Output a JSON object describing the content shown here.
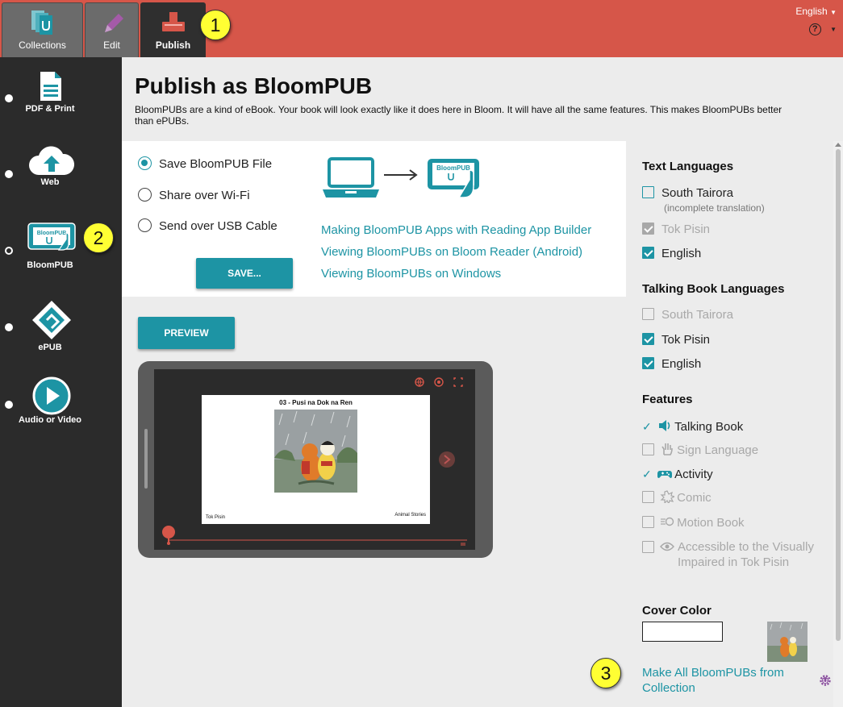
{
  "tabs": {
    "collections_label": "Collections",
    "edit_label": "Edit",
    "publish_label": "Publish"
  },
  "header": {
    "ui_language": "English",
    "help_glyph": "?"
  },
  "callouts": {
    "one": "1",
    "two": "2",
    "three": "3"
  },
  "sidebar": {
    "items": [
      {
        "label": "PDF & Print",
        "icon": "document-icon"
      },
      {
        "label": "Web",
        "icon": "cloud-upload-icon"
      },
      {
        "label": "BloomPUB",
        "icon": "bloompub-device-icon",
        "selected": true
      },
      {
        "label": "ePUB",
        "icon": "epub-icon"
      },
      {
        "label": "Audio or Video",
        "icon": "play-icon"
      }
    ]
  },
  "main": {
    "title": "Publish as BloomPUB",
    "description": "BloomPUBs are a kind of eBook. Your book will look exactly like it does here in Bloom. It will have all the same features. This makes BloomPUBs better than ePUBs.",
    "methods": [
      {
        "label": "Save BloomPUB File",
        "selected": true
      },
      {
        "label": "Share over Wi-Fi",
        "selected": false
      },
      {
        "label": "Send over USB Cable",
        "selected": false
      }
    ],
    "save_button": "SAVE...",
    "device_badge": "BloomPUB",
    "links": [
      "Making BloomPUB Apps with Reading App Builder",
      "Viewing BloomPUBs on Bloom Reader (Android)",
      "Viewing BloomPUBs on Windows"
    ],
    "preview_button": "PREVIEW",
    "preview": {
      "page_title": "03 - Pusi na Dok na Ren",
      "language": "Tok Pisin",
      "category": "Animal Stories"
    }
  },
  "settings": {
    "text_languages": {
      "heading": "Text Languages",
      "items": [
        {
          "label": "South Tairora",
          "checked": false,
          "disabled": false,
          "note": "(incomplete translation)"
        },
        {
          "label": "Tok Pisin",
          "checked": true,
          "disabled": true
        },
        {
          "label": "English",
          "checked": true,
          "disabled": false
        }
      ]
    },
    "talking_book_languages": {
      "heading": "Talking Book Languages",
      "items": [
        {
          "label": "South Tairora",
          "checked": false,
          "disabled": true
        },
        {
          "label": "Tok Pisin",
          "checked": true,
          "disabled": false
        },
        {
          "label": "English",
          "checked": true,
          "disabled": false
        }
      ]
    },
    "features": {
      "heading": "Features",
      "items": [
        {
          "label": "Talking Book",
          "present": true,
          "icon": "speaker-icon"
        },
        {
          "label": "Sign Language",
          "present": false,
          "icon": "hand-icon"
        },
        {
          "label": "Activity",
          "present": true,
          "icon": "gamepad-icon"
        },
        {
          "label": "Comic",
          "present": false,
          "icon": "comic-burst-icon"
        },
        {
          "label": "Motion Book",
          "present": false,
          "icon": "motion-icon"
        },
        {
          "label": "Accessible to the Visually Impaired in Tok Pisin",
          "present": false,
          "icon": "eye-icon"
        }
      ]
    },
    "cover_color": {
      "heading": "Cover Color",
      "value": "#ffffff"
    },
    "make_all_link": "Make All BloomPUBs from Collection"
  },
  "colors": {
    "topbar": "#d65649",
    "accent": "#1d94a4",
    "sidebar": "#2b2b2b",
    "callout": "#ffff33"
  }
}
